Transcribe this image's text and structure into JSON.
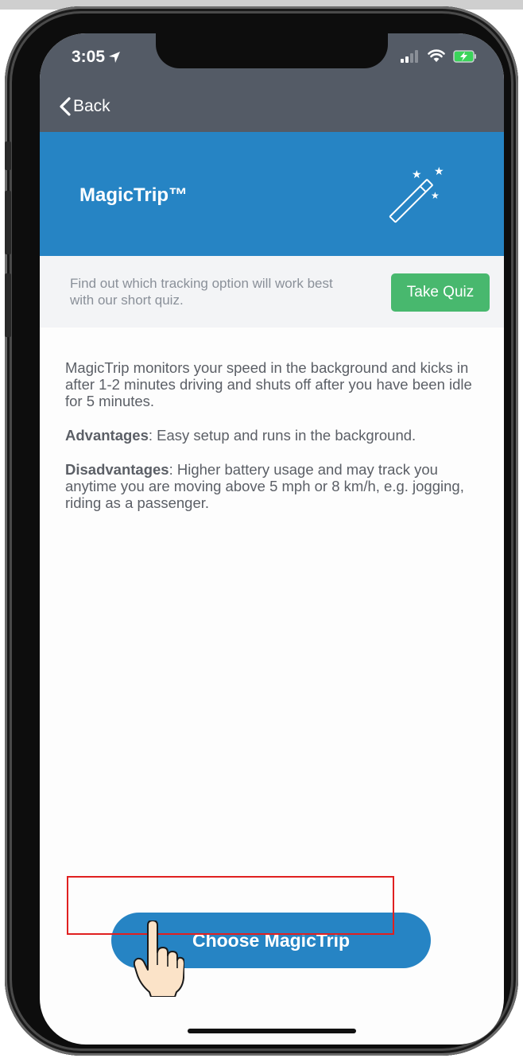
{
  "status_bar": {
    "time": "3:05"
  },
  "nav": {
    "back_label": "Back"
  },
  "hero": {
    "title": "MagicTrip™"
  },
  "quiz": {
    "text": "Find out which tracking option will work best with our short quiz.",
    "button_label": "Take Quiz"
  },
  "description": {
    "intro": "MagicTrip monitors your speed in the background and kicks in after 1-2 minutes driving and shuts off after you have been idle for 5 minutes.",
    "advantages_label": "Advantages",
    "advantages_text": ": Easy setup and runs in the background.",
    "disadvantages_label": "Disadvantages",
    "disadvantages_text": ": Higher battery usage and may track you anytime you are moving above 5 mph or 8 km/h, e.g. jogging, riding as a passenger."
  },
  "cta": {
    "label": "Choose MagicTrip"
  },
  "colors": {
    "nav_bg": "#545b66",
    "hero_bg": "#2684c4",
    "quiz_button": "#48b86e",
    "highlight": "#e02020"
  },
  "icons": [
    "location-arrow-icon",
    "signal-icon",
    "wifi-icon",
    "battery-charging-icon",
    "chevron-left-icon",
    "magic-wand-icon",
    "pointing-hand-icon"
  ]
}
